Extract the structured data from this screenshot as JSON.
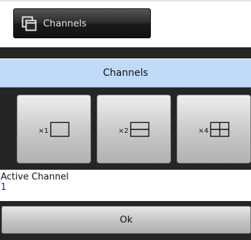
{
  "topbar": {
    "channels_label": "Channels",
    "icon": "channels-window-icon"
  },
  "dialog": {
    "title": "Channels",
    "layouts": [
      {
        "label": "×1",
        "icon": "single-pane-icon"
      },
      {
        "label": "×2",
        "icon": "two-pane-icon"
      },
      {
        "label": "×4",
        "icon": "four-pane-icon"
      }
    ],
    "active_channel": {
      "label": "Active Channel",
      "value": "1"
    },
    "ok_label": "Ok"
  },
  "colors": {
    "header_bg": "#bfdbf8",
    "active_value": "#2222cc",
    "panel_bg": "#252525"
  }
}
